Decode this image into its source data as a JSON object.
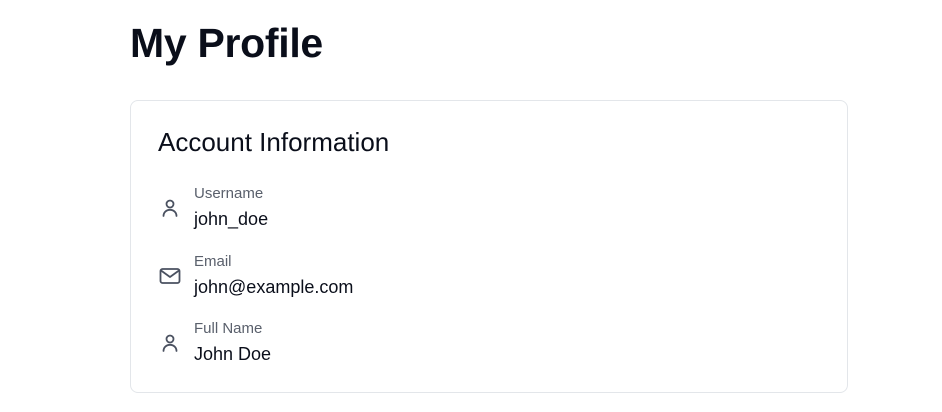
{
  "page": {
    "title": "My Profile"
  },
  "account_card": {
    "title": "Account Information",
    "fields": [
      {
        "label": "Username",
        "value": "john_doe",
        "icon": "user-icon"
      },
      {
        "label": "Email",
        "value": "john@example.com",
        "icon": "mail-icon"
      },
      {
        "label": "Full Name",
        "value": "John Doe",
        "icon": "user-icon"
      }
    ]
  }
}
